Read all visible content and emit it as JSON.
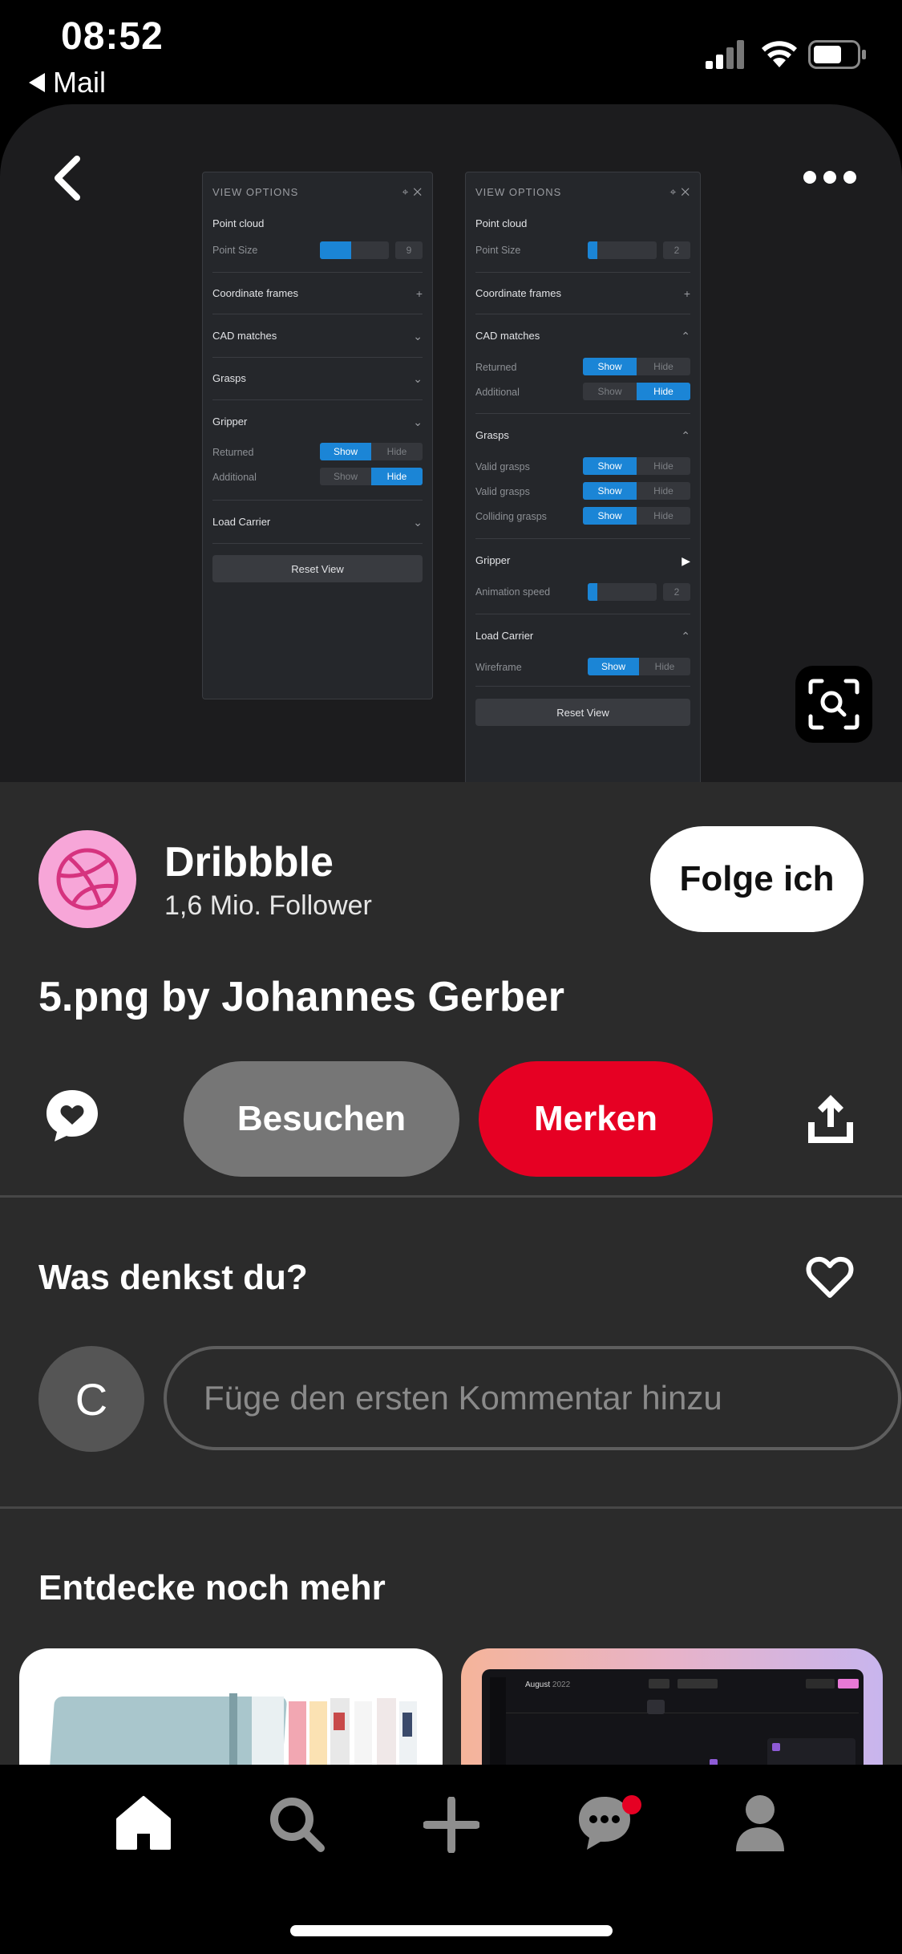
{
  "status": {
    "time": "08:52",
    "back_app": "Mail"
  },
  "pin": {
    "panels": [
      {
        "title": "VIEW OPTIONS",
        "point_cloud": "Point cloud",
        "point_size_label": "Point Size",
        "point_size_value": "9",
        "point_size_fraction": 0.45,
        "coordinate_frames": "Coordinate frames",
        "cad_matches": "CAD matches",
        "grasps": "Grasps",
        "gripper": "Gripper",
        "returned": "Returned",
        "additional": "Additional",
        "show": "Show",
        "hide": "Hide",
        "load_carrier": "Load Carrier",
        "reset": "Reset View"
      },
      {
        "title": "VIEW OPTIONS",
        "point_cloud": "Point cloud",
        "point_size_label": "Point Size",
        "point_size_value": "2",
        "point_size_fraction": 0.1,
        "coordinate_frames": "Coordinate frames",
        "cad_matches": "CAD matches",
        "returned": "Returned",
        "additional": "Additional",
        "grasps": "Grasps",
        "valid_grasps": "Valid grasps",
        "colliding_grasps": "Colliding grasps",
        "gripper": "Gripper",
        "animation_speed": "Animation speed",
        "animation_value": "2",
        "animation_fraction": 0.1,
        "load_carrier": "Load Carrier",
        "wireframe": "Wireframe",
        "show": "Show",
        "hide": "Hide",
        "reset": "Reset View"
      }
    ],
    "creator_name": "Dribbble",
    "followers": "1,6 Mio. Follower",
    "follow_button": "Folge ich",
    "title": "5.png by Johannes Gerber",
    "visit_button": "Besuchen",
    "save_button": "Merken",
    "comments_heading": "Was denkst du?",
    "avatar_letter": "C",
    "comment_placeholder": "Füge den ersten Kommentar hinzu",
    "explore_heading": "Entdecke noch mehr",
    "thumb_calendar_month": "August",
    "thumb_calendar_year": "2022"
  },
  "colors": {
    "accent_red": "#e60023",
    "brand_pink": "#f7a6d8",
    "dribbble_icon": "#d6337f",
    "toggle_blue": "#1b85d6"
  },
  "icons": [
    "back-icon",
    "more-icon",
    "visual-search-icon",
    "dribbble-logo-icon",
    "comment-heart-icon",
    "share-icon",
    "heart-outline-icon",
    "home-icon",
    "search-icon",
    "plus-icon",
    "messages-icon",
    "profile-icon"
  ]
}
